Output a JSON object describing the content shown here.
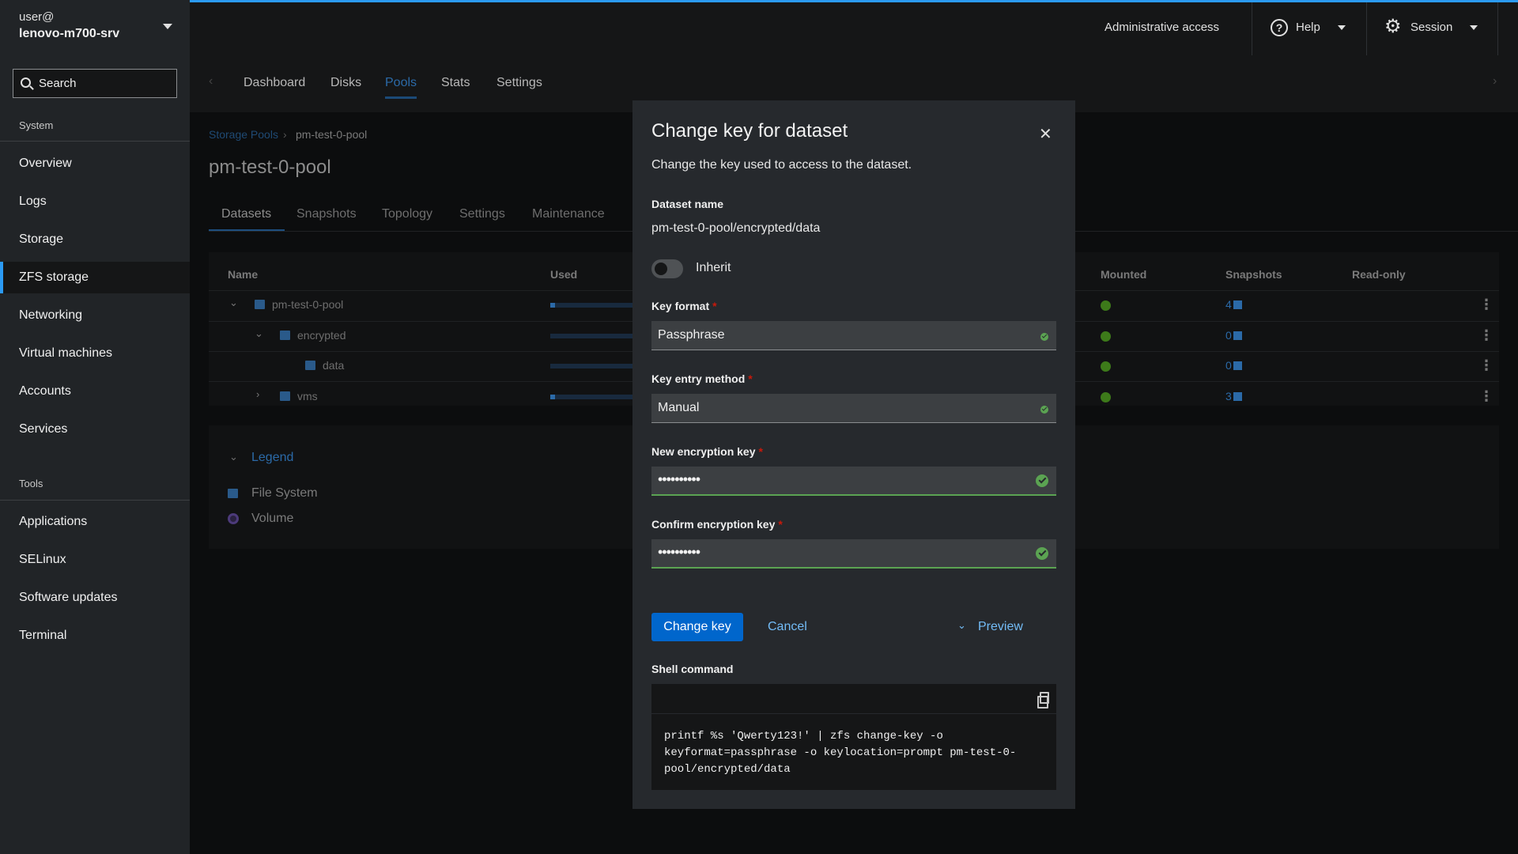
{
  "sidebar": {
    "user": "user@",
    "host": "lenovo-m700-srv",
    "search_placeholder": "Search",
    "sections": {
      "system": "System",
      "tools": "Tools"
    },
    "system_items": [
      "Overview",
      "Logs",
      "Storage",
      "ZFS storage",
      "Networking",
      "Virtual machines",
      "Accounts",
      "Services"
    ],
    "active_item": "ZFS storage",
    "tools_items": [
      "Applications",
      "SELinux",
      "Software updates",
      "Terminal"
    ]
  },
  "topbar": {
    "admin": "Administrative access",
    "help": "Help",
    "session": "Session"
  },
  "nav": {
    "tabs": [
      "Dashboard",
      "Disks",
      "Pools",
      "Stats",
      "Settings"
    ],
    "active": "Pools"
  },
  "breadcrumb": {
    "parent": "Storage Pools",
    "current": "pm-test-0-pool"
  },
  "pool_title": "pm-test-0-pool",
  "subtabs": {
    "items": [
      "Datasets",
      "Snapshots",
      "Topology",
      "Settings",
      "Maintenance"
    ],
    "active": "Datasets"
  },
  "table": {
    "headers": {
      "name": "Name",
      "used": "Used",
      "mounted": "Mounted",
      "snapshots": "Snapshots",
      "readonly": "Read-only"
    },
    "rows": [
      {
        "name": "pm-test-0-pool",
        "snapshots": "4",
        "used_fraction": 0.05
      },
      {
        "name": "encrypted",
        "snapshots": "0",
        "used_fraction": 0.0
      },
      {
        "name": "data",
        "snapshots": "0",
        "used_fraction": 0.0
      },
      {
        "name": "vms",
        "snapshots": "3",
        "used_fraction": 0.05
      }
    ]
  },
  "legend": {
    "title": "Legend",
    "items": [
      "File System",
      "Volume"
    ]
  },
  "modal": {
    "title": "Change key for dataset",
    "description": "Change the key used to access to the dataset.",
    "dataset_label": "Dataset name",
    "dataset_value": "pm-test-0-pool/encrypted/data",
    "inherit_label": "Inherit",
    "key_format_label": "Key format",
    "key_format_value": "Passphrase",
    "key_entry_label": "Key entry method",
    "key_entry_value": "Manual",
    "new_key_label": "New encryption key",
    "new_key_value": "••••••••••",
    "confirm_key_label": "Confirm encryption key",
    "confirm_key_value": "••••••••••",
    "required_mark": "*",
    "primary_button": "Change key",
    "cancel_button": "Cancel",
    "preview_label": "Preview",
    "shell_label": "Shell command",
    "shell_command": "printf %s 'Qwerty123!' | zfs change-key -o keyformat=passphrase -o keylocation=prompt pm-test-0-pool/encrypted/data"
  },
  "icons": {
    "host_menu": "caret-down-icon",
    "search": "search-icon",
    "help": "help-circle-icon",
    "session": "gear-icon",
    "close": "close-icon",
    "copy": "copy-icon",
    "valid": "check-circle-icon"
  },
  "colors": {
    "accent": "#2b9af3",
    "primary_button": "#0066cc",
    "link": "#73bcf7",
    "success": "#5ba352",
    "required": "#c9190b"
  }
}
